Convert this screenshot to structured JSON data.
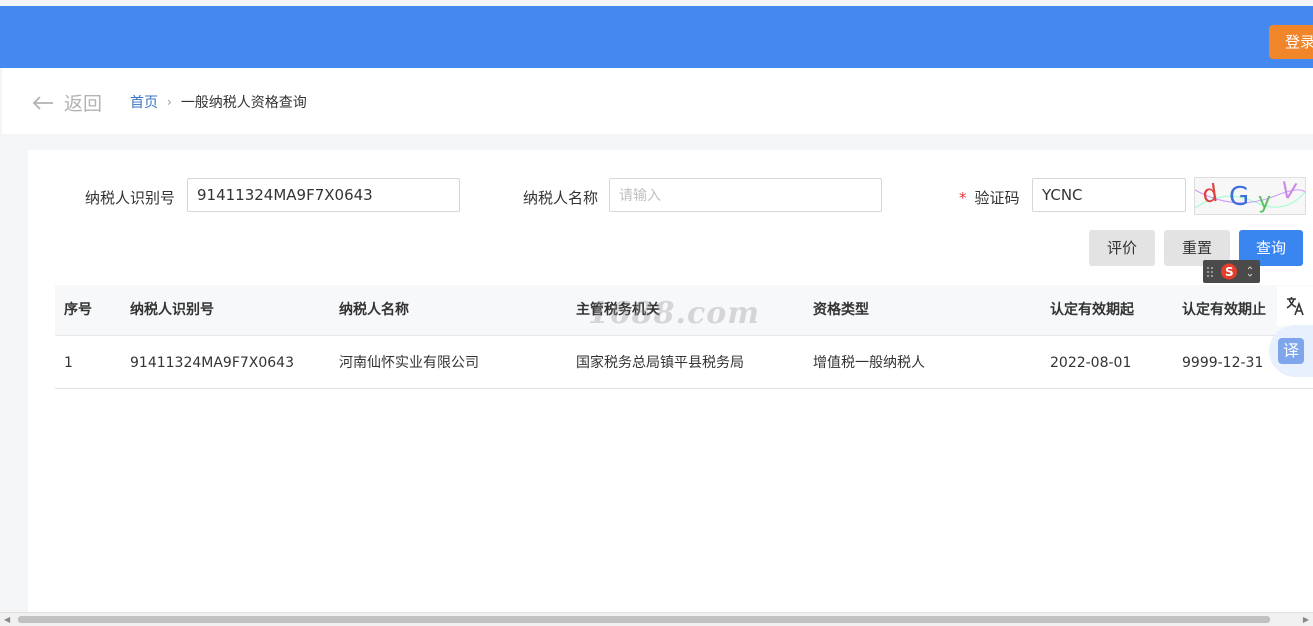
{
  "header": {
    "login_label": "登录"
  },
  "nav": {
    "back_label": "返回",
    "home_label": "首页",
    "separator": "›",
    "current_label": "一般纳税人资格查询"
  },
  "form": {
    "taxpayer_id_label": "纳税人识别号",
    "taxpayer_id_value": "91411324MA9F7X0643",
    "taxpayer_name_label": "纳税人名称",
    "taxpayer_name_value": "",
    "taxpayer_name_placeholder": "请输入",
    "captcha_required_mark": "*",
    "captcha_label": "验证码",
    "captcha_value": "YCNC",
    "captcha_image_text": "dGyV"
  },
  "buttons": {
    "rate": "评价",
    "reset": "重置",
    "query": "查询"
  },
  "table": {
    "headers": [
      "序号",
      "纳税人识别号",
      "纳税人名称",
      "主管税务机关",
      "资格类型",
      "认定有效期起",
      "认定有效期止"
    ],
    "rows": [
      [
        "1",
        "91411324MA9F7X0643",
        "河南仙怀实业有限公司",
        "国家税务总局镇平县税务局",
        "增值税一般纳税人",
        "2022-08-01",
        "9999-12-31"
      ]
    ]
  },
  "watermark": "1688.com",
  "side_tools": {
    "translate_label": "译"
  },
  "colors": {
    "header_blue": "#4589f0",
    "login_orange": "#f0852a",
    "query_blue": "#3a86f0",
    "link_blue": "#3a73c8",
    "required_red": "#e4393c"
  }
}
